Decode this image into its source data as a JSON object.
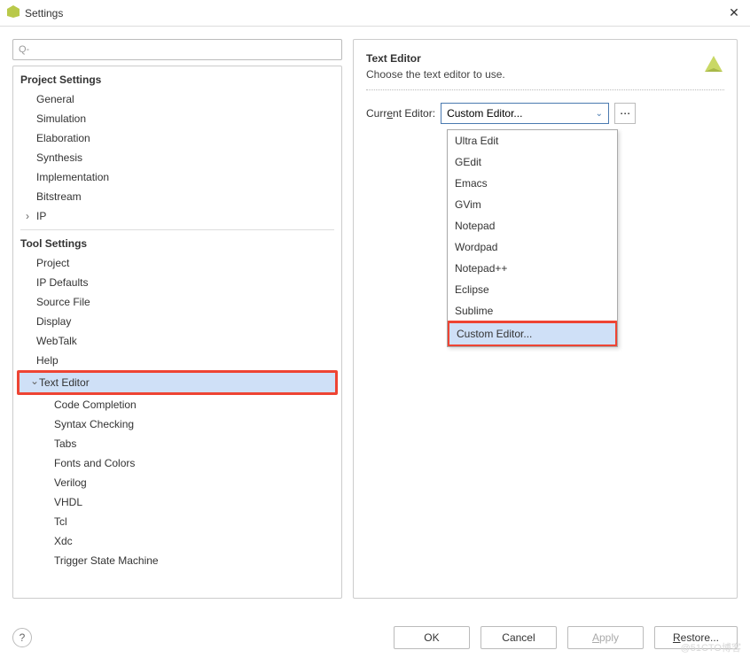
{
  "window": {
    "title": "Settings"
  },
  "search": {
    "placeholder": ""
  },
  "tree": {
    "section1": {
      "header": "Project Settings",
      "items": [
        "General",
        "Simulation",
        "Elaboration",
        "Synthesis",
        "Implementation",
        "Bitstream",
        "IP"
      ]
    },
    "section2": {
      "header": "Tool Settings",
      "items_top": [
        "Project",
        "IP Defaults",
        "Source File",
        "Display",
        "WebTalk",
        "Help"
      ],
      "text_editor": "Text Editor",
      "text_editor_children": [
        "Code Completion",
        "Syntax Checking",
        "Tabs",
        "Fonts and Colors",
        "Verilog",
        "VHDL",
        "Tcl",
        "Xdc",
        "Trigger State Machine"
      ]
    }
  },
  "right": {
    "heading": "Text Editor",
    "description": "Choose the text editor to use.",
    "current_editor_label": "Current Editor:",
    "current_editor_value": "Custom Editor...",
    "dropdown_options": [
      "Ultra Edit",
      "GEdit",
      "Emacs",
      "GVim",
      "Notepad",
      "Wordpad",
      "Notepad++",
      "Eclipse",
      "Sublime",
      "Custom Editor..."
    ]
  },
  "footer": {
    "ok": "OK",
    "cancel": "Cancel",
    "apply": "Apply",
    "restore": "Restore..."
  },
  "watermark": "@51CTO博客"
}
